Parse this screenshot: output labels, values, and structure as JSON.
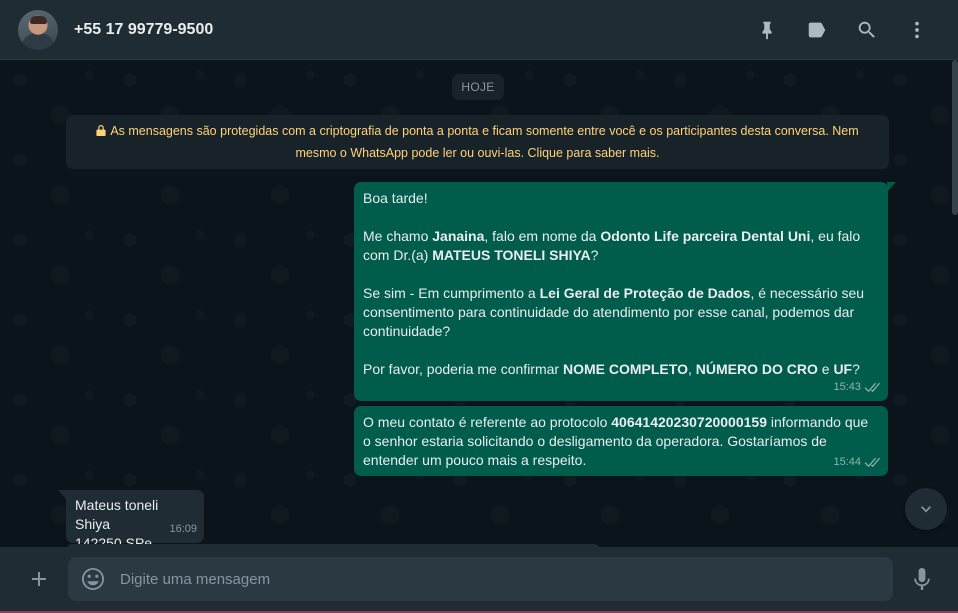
{
  "header": {
    "contact_name": "+55 17 99779-9500",
    "icons": [
      "pin-icon",
      "label-icon",
      "search-icon",
      "menu-icon"
    ]
  },
  "chat": {
    "date_chip": "HOJE",
    "encryption_notice": "As mensagens são protegidas com a criptografia de ponta a ponta e ficam somente entre você e os participantes desta conversa. Nem mesmo o WhatsApp pode ler ou ouvi-las. Clique para saber mais.",
    "messages": [
      {
        "direction": "outgoing",
        "time": "15:43",
        "status": "delivered",
        "paragraphs": [
          {
            "parts": [
              {
                "text": "Boa tarde!",
                "bold": false
              }
            ]
          },
          {
            "parts": [
              {
                "text": "Me chamo ",
                "bold": false
              },
              {
                "text": "Janaina",
                "bold": true
              },
              {
                "text": ", falo em nome da ",
                "bold": false
              },
              {
                "text": "Odonto Life parceira Dental Uni",
                "bold": true
              },
              {
                "text": ", eu falo com Dr.(a) ",
                "bold": false
              },
              {
                "text": "MATEUS TONELI SHIYA",
                "bold": true
              },
              {
                "text": "?",
                "bold": false
              }
            ]
          },
          {
            "parts": [
              {
                "text": "Se sim - Em cumprimento a ",
                "bold": false
              },
              {
                "text": "Lei Geral de Proteção de Dados",
                "bold": true
              },
              {
                "text": ", é necessário seu consentimento para continuidade do atendimento por esse canal, podemos dar continuidade?",
                "bold": false
              }
            ]
          },
          {
            "parts": [
              {
                "text": "Por favor, poderia me confirmar ",
                "bold": false
              },
              {
                "text": "NOME COMPLETO",
                "bold": true
              },
              {
                "text": ", ",
                "bold": false
              },
              {
                "text": "NÚMERO DO CRO",
                "bold": true
              },
              {
                "text": " e ",
                "bold": false
              },
              {
                "text": "UF",
                "bold": true
              },
              {
                "text": "?",
                "bold": false
              }
            ]
          }
        ]
      },
      {
        "direction": "outgoing",
        "time": "15:44",
        "status": "delivered",
        "paragraphs": [
          {
            "parts": [
              {
                "text": "O meu contato é referente ao protocolo ",
                "bold": false
              },
              {
                "text": "40641420230720000159",
                "bold": true
              },
              {
                "text": " informando que o senhor estaria solicitando o desligamento da operadora. Gostaríamos de entender um pouco mais a respeito.",
                "bold": false
              }
            ]
          }
        ]
      },
      {
        "direction": "incoming",
        "time": "16:09",
        "lines": [
          "Mateus toneli Shiya",
          "142250 SPe"
        ]
      }
    ]
  },
  "footer": {
    "input_placeholder": "Digite uma mensagem"
  },
  "colors": {
    "outgoing_bubble": "#005c4b",
    "incoming_bubble": "#202c33",
    "header_bg": "#202c33",
    "chat_bg": "#0b141a",
    "notice_text": "#ffd279"
  }
}
